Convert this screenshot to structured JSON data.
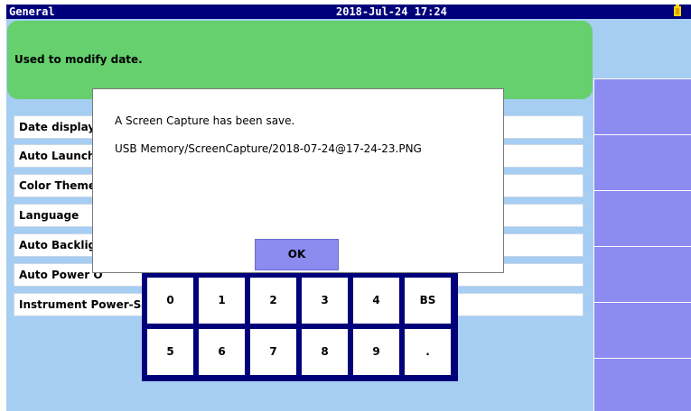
{
  "titlebar": {
    "title": "General",
    "datetime": "2018-Jul-24 17:24",
    "battery_icon": "battery-icon"
  },
  "info": {
    "text": "Used to modify date."
  },
  "settings": [
    {
      "label": "Date display"
    },
    {
      "label": "Auto Launch"
    },
    {
      "label": "Color Theme"
    },
    {
      "label": "Language"
    },
    {
      "label": "Auto Backlig"
    },
    {
      "label": "Auto Power O"
    },
    {
      "label": "Instrument Power-Sav"
    }
  ],
  "keypad": {
    "row1": [
      "0",
      "1",
      "2",
      "3",
      "4",
      "BS"
    ],
    "row2": [
      "5",
      "6",
      "7",
      "8",
      "9",
      "."
    ]
  },
  "dialog": {
    "message": "A Screen Capture has been save.",
    "path": "USB Memory/ScreenCapture/2018-07-24@17-24-23.PNG",
    "ok_label": "OK"
  },
  "colors": {
    "titlebar": "#00007a",
    "background": "#a6cdf2",
    "info_panel": "#65d06d",
    "side_button": "#8b8bf0",
    "ok_button": "#8b8bf0"
  }
}
